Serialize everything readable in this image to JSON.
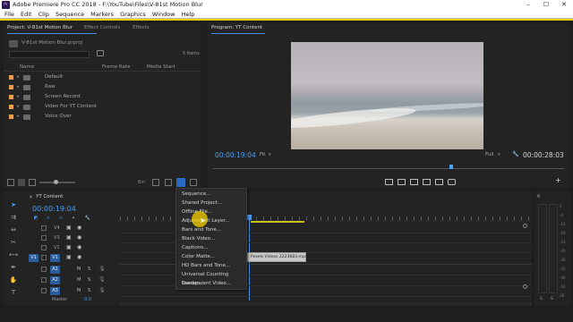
{
  "window": {
    "title": "Adobe Premiere Pro CC 2018 - F:\\YouTube\\Files\\V-81st Motion Blur",
    "app_icon": "Pr",
    "minimize": "–",
    "maximize": "☐",
    "close": "✕"
  },
  "menu": [
    "File",
    "Edit",
    "Clip",
    "Sequence",
    "Markers",
    "Graphics",
    "Window",
    "Help"
  ],
  "project_panel": {
    "tabs": [
      "Project: V-81st Motion Blur",
      "Effect Controls",
      "Effects"
    ],
    "project_file": "V-81st Motion Blur.prproj",
    "item_count": "5 Items",
    "columns": [
      "Name",
      "Frame Rate",
      "Media Start"
    ],
    "items": [
      {
        "label": "Default",
        "color": "#e8a050"
      },
      {
        "label": "Raw",
        "color": "#e8a050"
      },
      {
        "label": "Screen Record",
        "color": "#e8a050"
      },
      {
        "label": "Video For YT Content",
        "color": "#e8a050"
      },
      {
        "label": "Voice Over",
        "color": "#e8a050"
      }
    ],
    "bin_label": "Bin"
  },
  "program_monitor": {
    "title": "Program: YT Content",
    "timecode": "00:00:19:04",
    "fit": "Fit",
    "resolution": "Full",
    "duration": "00:00:28:03"
  },
  "timeline": {
    "tab": "YT Content",
    "timecode": "00:00:19:04",
    "tracks": [
      {
        "label": "V4"
      },
      {
        "label": "V3"
      },
      {
        "label": "V2"
      },
      {
        "label": "V1",
        "source": "V1"
      },
      {
        "label": "A1",
        "toggles": [
          "M",
          "S"
        ]
      },
      {
        "label": "A2",
        "toggles": [
          "M",
          "S"
        ]
      },
      {
        "label": "A3",
        "toggles": [
          "M",
          "S"
        ]
      }
    ],
    "master_label": "Master",
    "master_value": "0.0",
    "clip_name": "Pexels Videos 2223683.mp4"
  },
  "new_item_menu": {
    "items": [
      "Sequence...",
      "Shared Project...",
      "Offline File...",
      "Adjustment Layer...",
      "Bars and Tone...",
      "Black Video...",
      "Captions...",
      "Color Matte...",
      "HD Bars and Tone...",
      "Universal Counting Leader...",
      "Transparent Video..."
    ]
  },
  "meter": {
    "labels": [
      "0",
      "-6",
      "-12",
      "-18",
      "-24",
      "-30",
      "-36",
      "-42",
      "-48",
      "-54"
    ],
    "scale": "dB",
    "solo": [
      "S",
      "S"
    ]
  },
  "colors": {
    "accent_blue": "#3c8ee8",
    "timecode_blue": "#4c9df6",
    "highlight_yellow": "#f5d000",
    "folder_orange": "#e8a050"
  }
}
